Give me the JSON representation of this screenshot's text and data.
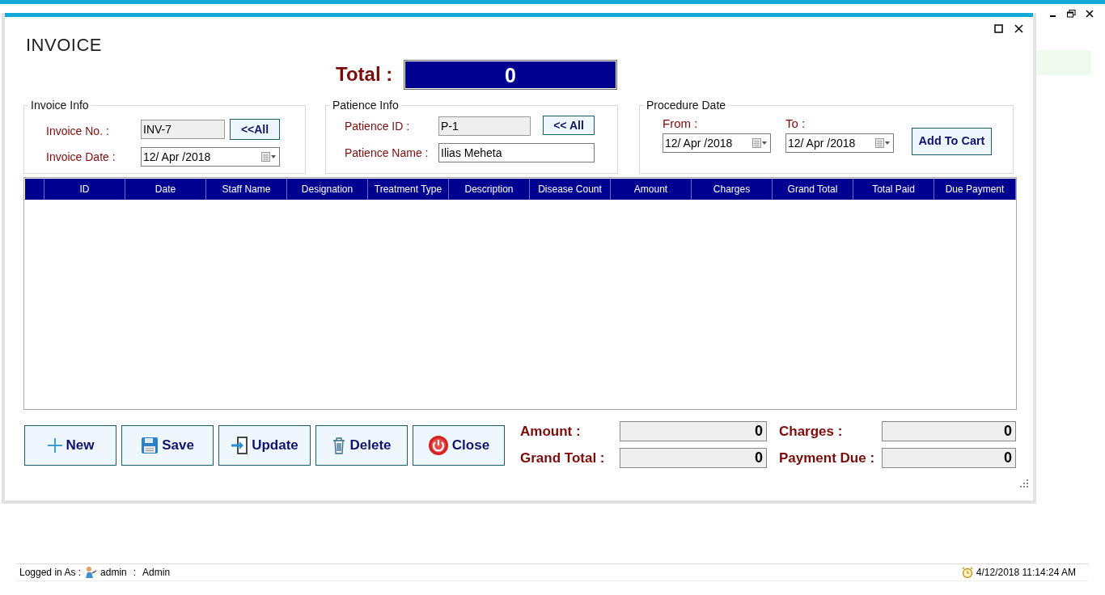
{
  "window": {
    "title": "INVOICE"
  },
  "total": {
    "label": "Total :",
    "value": "0"
  },
  "invoice_info": {
    "legend": "Invoice Info",
    "fields": [
      {
        "label": "Invoice No. :",
        "value": "INV-7",
        "kind": "readonly"
      },
      {
        "label": "Invoice Date :",
        "value": "12/ Apr /2018",
        "kind": "date"
      }
    ],
    "button": "<<All"
  },
  "patience_info": {
    "legend": "Patience Info",
    "fields": [
      {
        "label": "Patience ID :",
        "value": "P-1",
        "kind": "readonly"
      },
      {
        "label": "Patience Name :",
        "value": "Ilias Meheta",
        "kind": "text"
      }
    ],
    "button": "<< All"
  },
  "procedure_date": {
    "legend": "Procedure Date",
    "fields": [
      {
        "label": "From :",
        "value": "12/ Apr /2018",
        "kind": "date"
      },
      {
        "label": "To :",
        "value": "12/ Apr /2018",
        "kind": "date"
      }
    ],
    "button": "Add To Cart"
  },
  "table": {
    "columns": [
      "ID",
      "Date",
      "Staff Name",
      "Designation",
      "Treatment Type",
      "Description",
      "Disease Count",
      "Amount",
      "Charges",
      "Grand Total",
      "Total Paid",
      "Due Payment"
    ]
  },
  "buttons": [
    {
      "label": "New",
      "kind": "plus"
    },
    {
      "label": "Save",
      "kind": "floppy"
    },
    {
      "label": "Update",
      "kind": "enter"
    },
    {
      "label": "Delete",
      "kind": "trash"
    },
    {
      "label": "Close",
      "kind": "power"
    }
  ],
  "summary": [
    {
      "label": "Amount :",
      "value": "0"
    },
    {
      "label": "Charges :",
      "value": "0"
    },
    {
      "label": "Grand Total :",
      "value": "0"
    },
    {
      "label": "Payment Due :",
      "value": "0"
    }
  ],
  "status_bar": {
    "logged_in_label": "Logged in As :",
    "user": "admin",
    "separator": ":",
    "role": "Admin",
    "datetime": "4/12/2018 11:14:24 AM"
  }
}
